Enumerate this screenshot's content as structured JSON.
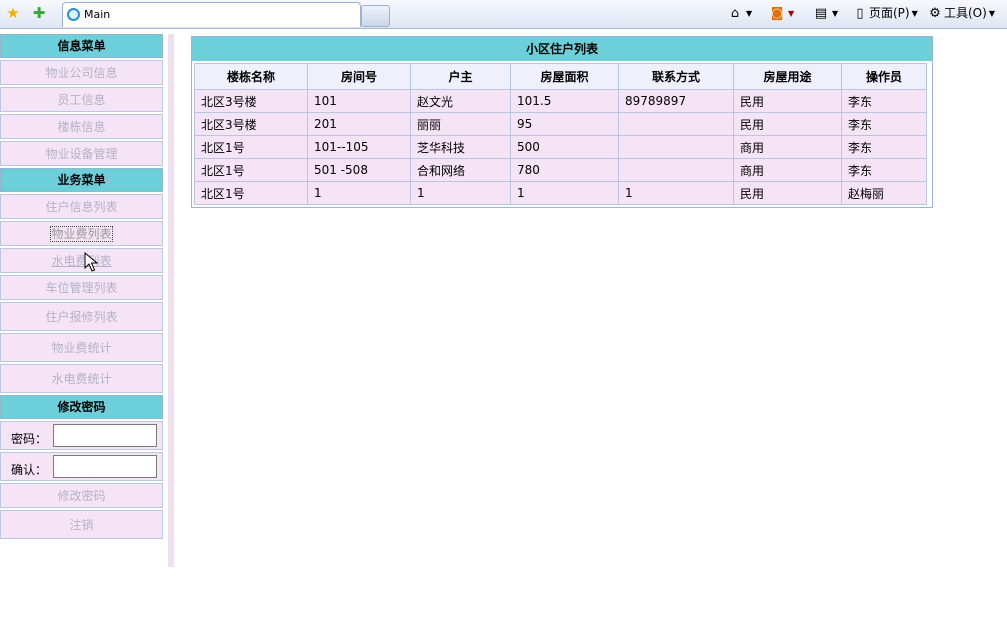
{
  "browser": {
    "tab_title": "Main",
    "page_menu": "页面(P)",
    "tools_menu": "工具(O)"
  },
  "sidebar": {
    "info_header": "信息菜单",
    "info_items": [
      "物业公司信息",
      "员工信息",
      "楼栋信息",
      "物业设备管理"
    ],
    "biz_header": "业务菜单",
    "biz_items": [
      "住户信息列表",
      "物业费列表",
      "水电费列表",
      "车位管理列表",
      "住户报修列表",
      "物业费统计",
      "水电费统计"
    ],
    "pw_header": "修改密码",
    "pw_label": "密码：",
    "confirm_label": "确认：",
    "change_pw": "修改密码",
    "logout": "注销"
  },
  "main": {
    "title": "小区住户列表",
    "columns": [
      "楼栋名称",
      "房间号",
      "户主",
      "房屋面积",
      "联系方式",
      "房屋用途",
      "操作员"
    ],
    "rows": [
      [
        "北区3号楼",
        "101",
        "赵文光",
        "101.5",
        "89789897",
        "民用",
        "李东"
      ],
      [
        "北区3号楼",
        "201",
        "丽丽",
        "95",
        "",
        "民用",
        "李东"
      ],
      [
        "北区1号",
        "101--105",
        "芝华科技",
        "500",
        "",
        "商用",
        "李东"
      ],
      [
        "北区1号",
        "501 -508",
        "合和网络",
        "780",
        "",
        "商用",
        "李东"
      ],
      [
        "北区1号",
        "1",
        "1",
        "1",
        "1",
        "民用",
        "赵梅丽"
      ]
    ]
  },
  "colors": {
    "header_bg": "#6dcfd9",
    "item_bg": "#f5e4f5"
  }
}
